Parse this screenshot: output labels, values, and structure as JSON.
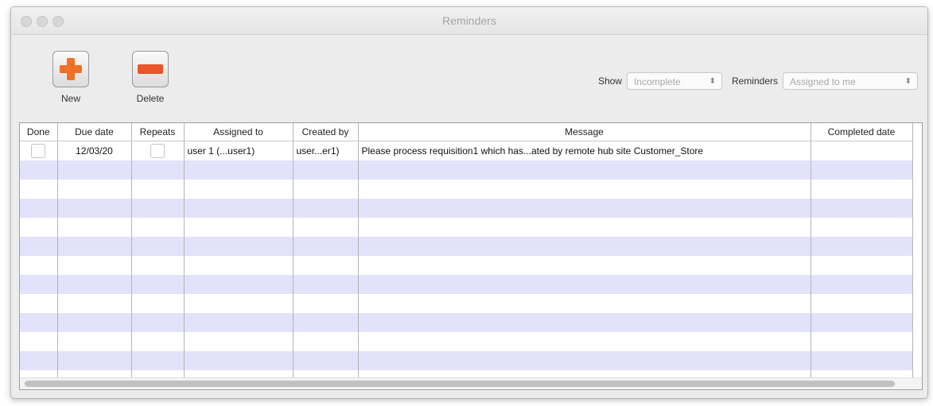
{
  "window": {
    "title": "Reminders"
  },
  "toolbar": {
    "new_label": "New",
    "delete_label": "Delete"
  },
  "filters": {
    "show_label": "Show",
    "show_value": "Incomplete",
    "reminders_label": "Reminders",
    "reminders_value": "Assigned to me"
  },
  "table": {
    "columns": [
      "Done",
      "Due date",
      "Repeats",
      "Assigned to",
      "Created by",
      "Message",
      "Completed date"
    ],
    "rows": [
      {
        "done": "",
        "due_date": "12/03/20",
        "repeats": "",
        "assigned_to": "user 1 (...user1)",
        "created_by": "user...er1)",
        "message": "Please process requisition1 which has...ated by remote hub site Customer_Store",
        "completed_date": ""
      }
    ]
  },
  "colors": {
    "accent_orange": "#f07028",
    "row_stripe": "#e2e2fb"
  },
  "icons": {
    "new": "plus-icon",
    "delete": "minus-icon",
    "select_arrows": "updown-chevron-icon"
  }
}
